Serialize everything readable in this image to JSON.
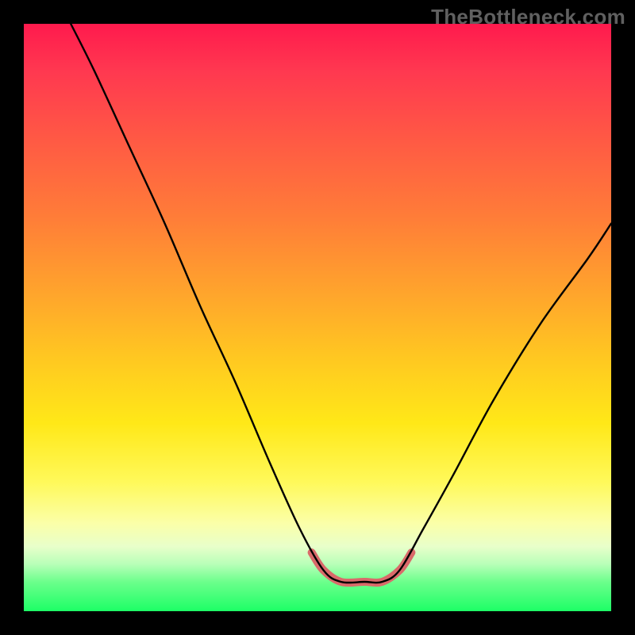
{
  "watermark": "TheBottleneck.com",
  "chart_data": {
    "type": "line",
    "title": "",
    "xlabel": "",
    "ylabel": "",
    "xlim": [
      0,
      100
    ],
    "ylim": [
      0,
      100
    ],
    "series": [
      {
        "name": "black-curve",
        "color": "#000000",
        "width": 2.4,
        "points": [
          {
            "x": 8,
            "y": 100
          },
          {
            "x": 12,
            "y": 92
          },
          {
            "x": 18,
            "y": 79
          },
          {
            "x": 24,
            "y": 66
          },
          {
            "x": 30,
            "y": 52
          },
          {
            "x": 36,
            "y": 39
          },
          {
            "x": 42,
            "y": 25
          },
          {
            "x": 47,
            "y": 14
          },
          {
            "x": 51,
            "y": 7
          },
          {
            "x": 54,
            "y": 5
          },
          {
            "x": 58,
            "y": 5
          },
          {
            "x": 61,
            "y": 5
          },
          {
            "x": 64,
            "y": 7
          },
          {
            "x": 68,
            "y": 14
          },
          {
            "x": 73,
            "y": 23
          },
          {
            "x": 80,
            "y": 36
          },
          {
            "x": 88,
            "y": 49
          },
          {
            "x": 96,
            "y": 60
          },
          {
            "x": 100,
            "y": 66
          }
        ]
      },
      {
        "name": "highlight-valley",
        "color": "#d96a6a",
        "width": 10,
        "points": [
          {
            "x": 49,
            "y": 10
          },
          {
            "x": 51,
            "y": 7
          },
          {
            "x": 54,
            "y": 5
          },
          {
            "x": 58,
            "y": 5
          },
          {
            "x": 61,
            "y": 5
          },
          {
            "x": 64,
            "y": 7
          },
          {
            "x": 66,
            "y": 10
          }
        ]
      }
    ],
    "gradient_stops": [
      {
        "pos": 0,
        "color": "#ff1a4d"
      },
      {
        "pos": 33,
        "color": "#ff7d38"
      },
      {
        "pos": 68,
        "color": "#ffe818"
      },
      {
        "pos": 92,
        "color": "#b8ffb8"
      },
      {
        "pos": 100,
        "color": "#1dff66"
      }
    ]
  }
}
